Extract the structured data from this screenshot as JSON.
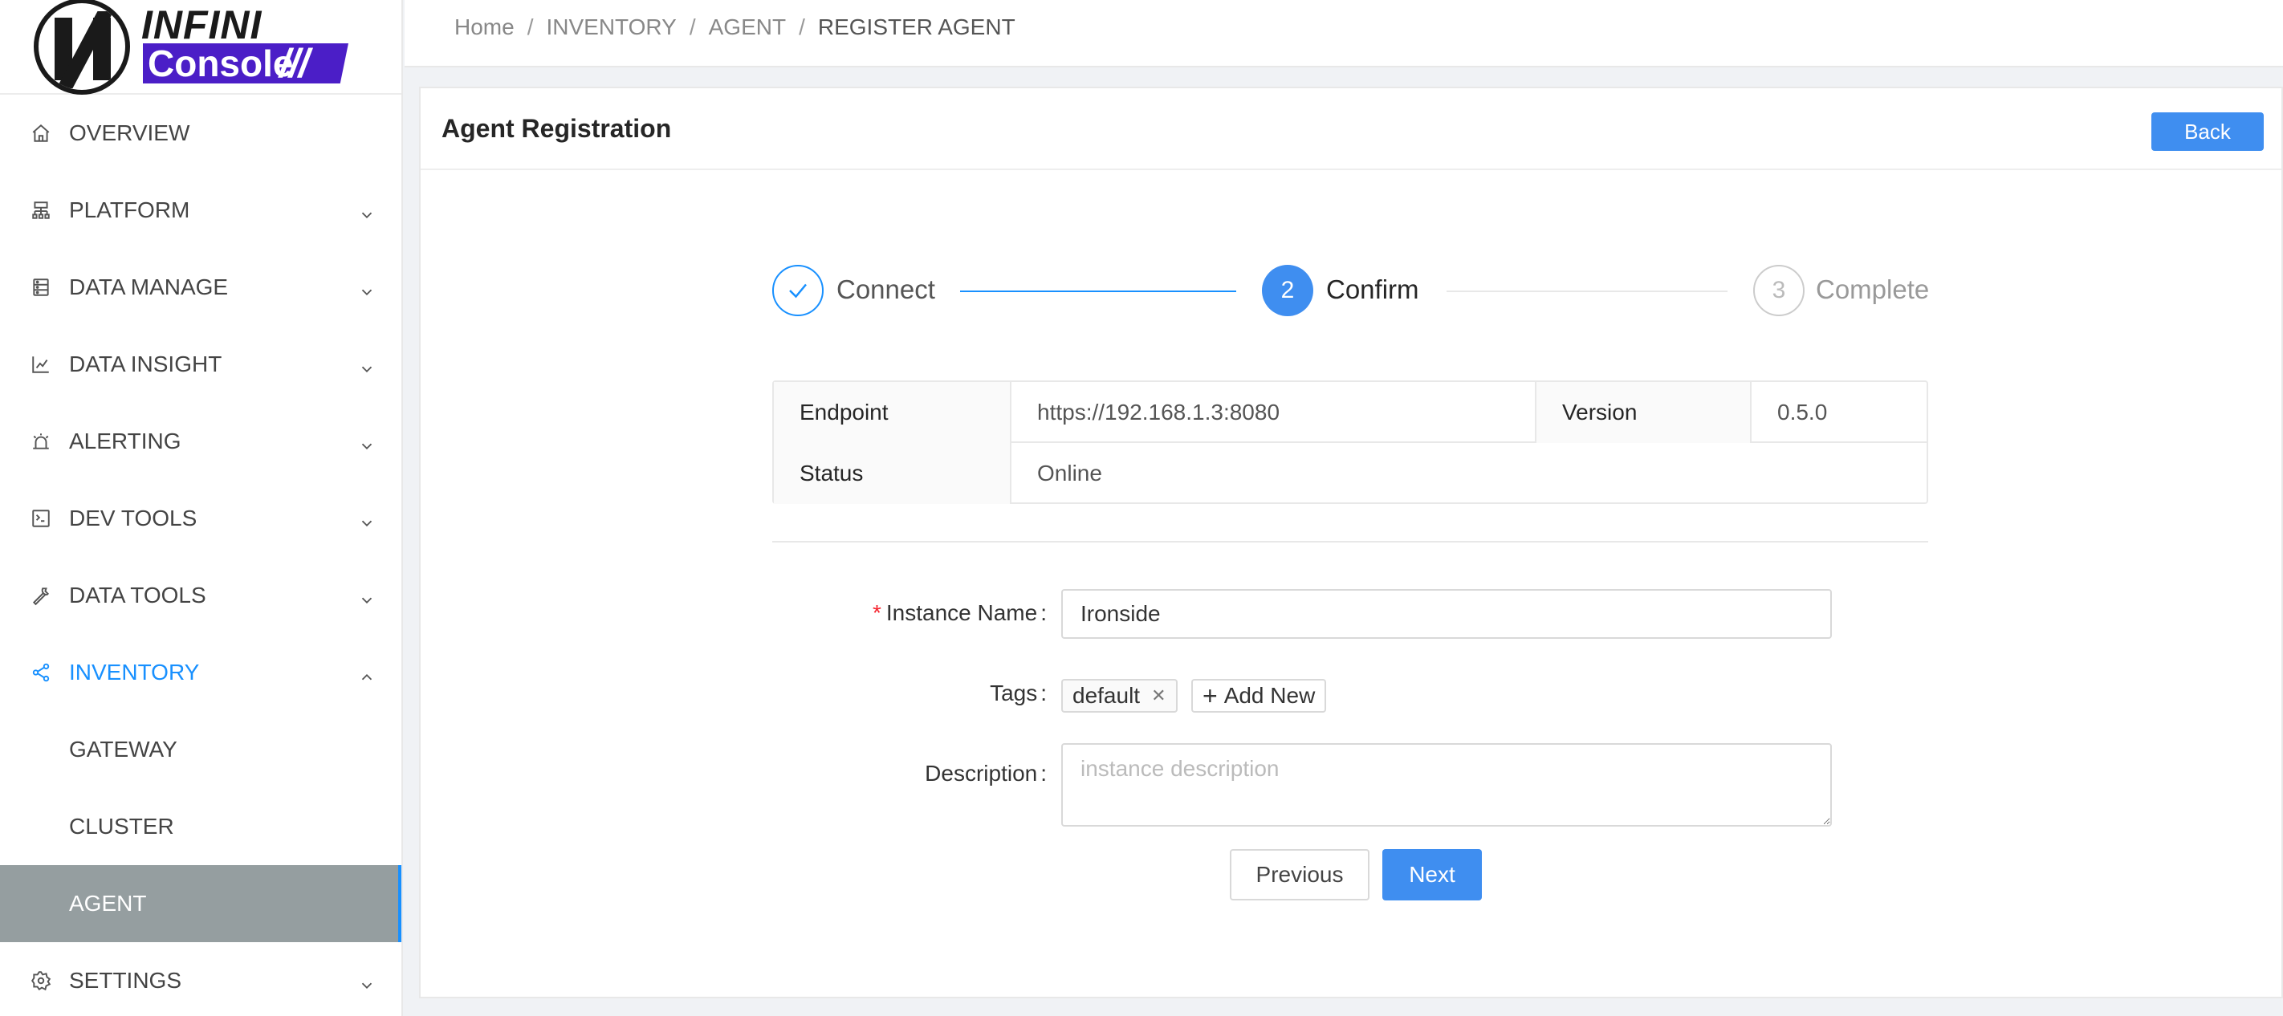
{
  "logo": {
    "top": "INFINI",
    "bottom": "Console",
    "slashes": "///"
  },
  "breadcrumb": [
    "Home",
    "INVENTORY",
    "AGENT",
    "REGISTER AGENT"
  ],
  "sidebar": {
    "items": [
      {
        "label": "OVERVIEW",
        "icon": "home-icon"
      },
      {
        "label": "PLATFORM",
        "icon": "platform-icon"
      },
      {
        "label": "DATA MANAGE",
        "icon": "database-icon"
      },
      {
        "label": "DATA INSIGHT",
        "icon": "chart-icon"
      },
      {
        "label": "ALERTING",
        "icon": "alarm-icon"
      },
      {
        "label": "DEV TOOLS",
        "icon": "terminal-icon"
      },
      {
        "label": "DATA TOOLS",
        "icon": "wrench-icon"
      },
      {
        "label": "INVENTORY",
        "icon": "share-icon"
      },
      {
        "label": "SETTINGS",
        "icon": "gear-icon"
      }
    ],
    "inventory_sub": [
      "GATEWAY",
      "CLUSTER",
      "AGENT"
    ]
  },
  "card": {
    "title": "Agent Registration",
    "back_label": "Back"
  },
  "steps": [
    {
      "number": "1",
      "label": "Connect",
      "status": "finished"
    },
    {
      "number": "2",
      "label": "Confirm",
      "status": "current"
    },
    {
      "number": "3",
      "label": "Complete",
      "status": "waiting"
    }
  ],
  "info": {
    "endpoint_label": "Endpoint",
    "endpoint_value": "https://192.168.1.3:8080",
    "version_label": "Version",
    "version_value": "0.5.0",
    "status_label": "Status",
    "status_value": "Online"
  },
  "form": {
    "instance_name_label": "Instance Name",
    "instance_name_value": "Ironside",
    "tags_label": "Tags",
    "tags": [
      "default"
    ],
    "add_tag_label": "Add New",
    "description_label": "Description",
    "description_placeholder": "instance description",
    "colon": ":",
    "required_mark": "*"
  },
  "buttons": {
    "previous": "Previous",
    "next": "Next"
  },
  "colors": {
    "accent": "#1890ff",
    "primary_button": "#3f8ef0",
    "selected_bg": "#959ea0"
  }
}
